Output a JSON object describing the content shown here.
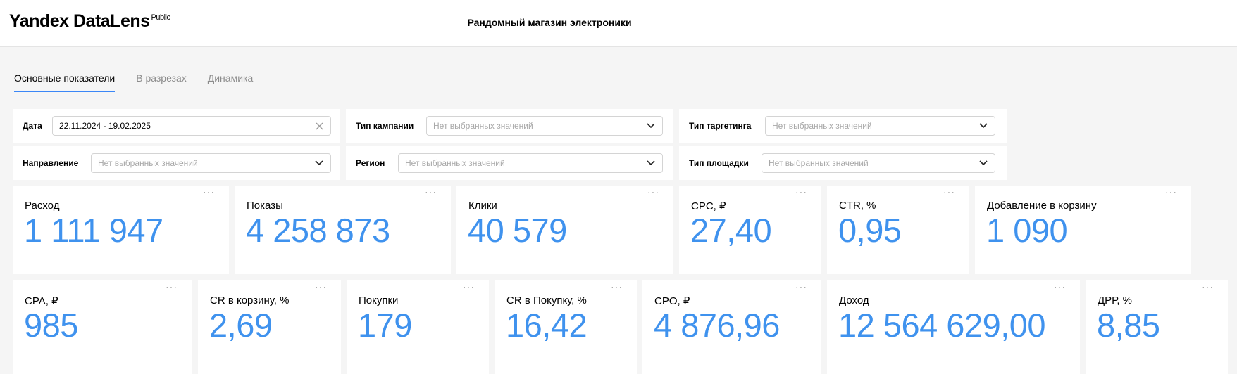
{
  "header": {
    "logo_text": "Yandex DataLens",
    "logo_badge": "Public",
    "dashboard_title": "Рандомный магазин электроники"
  },
  "tabs": [
    {
      "label": "Основные показатели",
      "active": true
    },
    {
      "label": "В разрезах",
      "active": false
    },
    {
      "label": "Динамика",
      "active": false
    }
  ],
  "filters": {
    "date": {
      "label": "Дата",
      "value": "22.11.2024 - 19.02.2025"
    },
    "campaign_type": {
      "label": "Тип кампании",
      "placeholder": "Нет выбранных значений"
    },
    "targeting_type": {
      "label": "Тип таргетинга",
      "placeholder": "Нет выбранных значений"
    },
    "direction": {
      "label": "Направление",
      "placeholder": "Нет выбранных значений"
    },
    "region": {
      "label": "Регион",
      "placeholder": "Нет выбранных значений"
    },
    "site_type": {
      "label": "Тип площадки",
      "placeholder": "Нет выбранных значений"
    }
  },
  "kpi_row1": [
    {
      "label": "Расход",
      "value": "1 111 947"
    },
    {
      "label": "Показы",
      "value": "4 258 873"
    },
    {
      "label": "Клики",
      "value": "40 579"
    },
    {
      "label": "CPC, ₽",
      "value": "27,40"
    },
    {
      "label": "CTR, %",
      "value": "0,95"
    },
    {
      "label": "Добавление в корзину",
      "value": "1 090"
    }
  ],
  "kpi_row2": [
    {
      "label": "CPA, ₽",
      "value": "985"
    },
    {
      "label": "CR в корзину, %",
      "value": "2,69"
    },
    {
      "label": "Покупки",
      "value": "179"
    },
    {
      "label": "CR в Покупку, %",
      "value": "16,42"
    },
    {
      "label": "CPO, ₽",
      "value": "4 876,96"
    },
    {
      "label": "Доход",
      "value": "12 564 629,00"
    },
    {
      "label": "ДРР, %",
      "value": "8,85"
    }
  ],
  "card_menu_symbol": "···",
  "colors": {
    "accent": "#3b87f7",
    "kpi_value": "#3f92ee",
    "background": "#f5f5f5"
  },
  "icons": {
    "clear": "close-icon",
    "dropdown": "chevron-down-icon",
    "menu": "more-dots-icon"
  }
}
